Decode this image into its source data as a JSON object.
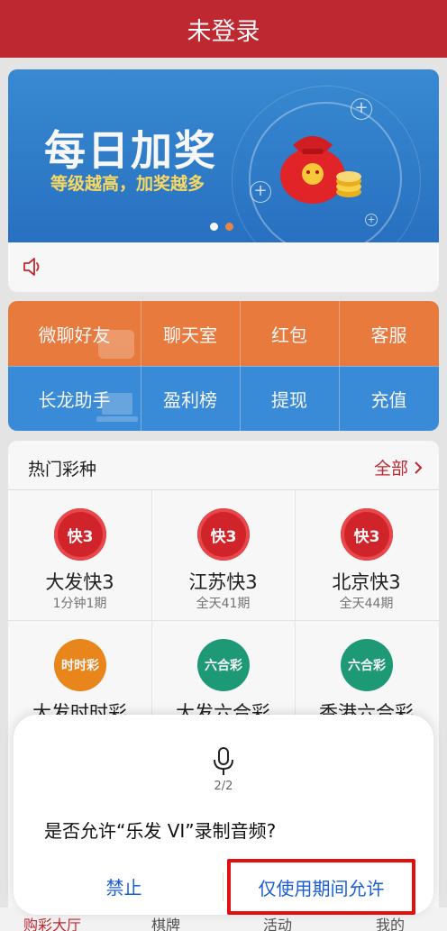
{
  "header": {
    "title": "未登录"
  },
  "banner": {
    "title": "每日加奖",
    "subtitle": "等级越高，加奖越多",
    "page_indicator": {
      "count": 2,
      "active_index": 1
    }
  },
  "quick_links": [
    {
      "label": "微聊好友"
    },
    {
      "label": "聊天室"
    },
    {
      "label": "红包"
    },
    {
      "label": "客服"
    },
    {
      "label": "长龙助手"
    },
    {
      "label": "盈利榜"
    },
    {
      "label": "提现"
    },
    {
      "label": "充值"
    }
  ],
  "games": {
    "section_title": "热门彩种",
    "all_label": "全部",
    "items": [
      {
        "name": "大发快3",
        "sub": "1分钟1期",
        "icon": "快3"
      },
      {
        "name": "江苏快3",
        "sub": "全天41期",
        "icon": "快3"
      },
      {
        "name": "北京快3",
        "sub": "全天44期",
        "icon": "快3"
      },
      {
        "name": "大发时时彩",
        "sub": "",
        "icon": "时时彩"
      },
      {
        "name": "大发六合彩",
        "sub": "",
        "icon": "六合彩"
      },
      {
        "name": "香港六合彩",
        "sub": "",
        "icon": "六合彩"
      }
    ]
  },
  "tabbar": {
    "items": [
      "购彩大厅",
      "棋牌",
      "活动",
      "我的"
    ]
  },
  "dialog": {
    "counter": "2/2",
    "message": "是否允许“乐发 VI”录制音频?",
    "deny_label": "禁止",
    "allow_label": "仅使用期间允许"
  },
  "colors": {
    "brand_red": "#c52a33",
    "orange": "#f07e3f",
    "blue": "#3b8fde",
    "link_blue": "#1a5fd8",
    "highlight": "#e01010"
  }
}
